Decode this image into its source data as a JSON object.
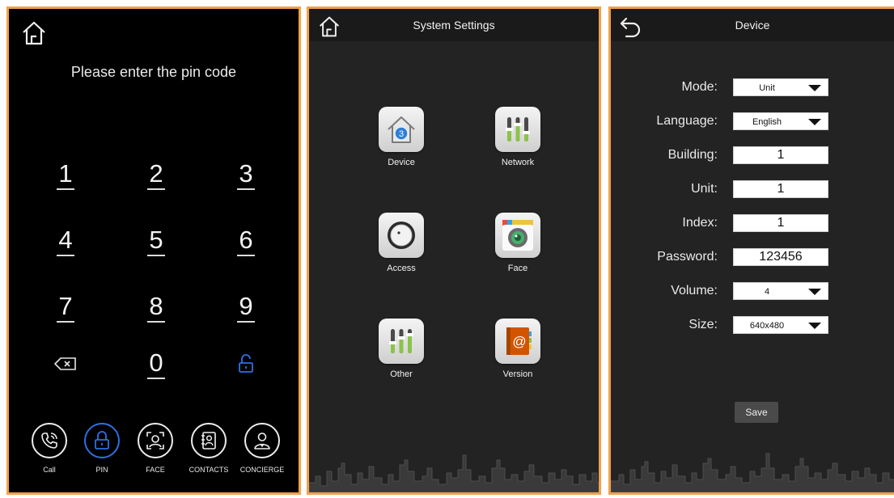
{
  "pin_screen": {
    "prompt": "Please enter the pin code",
    "keys": [
      "1",
      "2",
      "3",
      "4",
      "5",
      "6",
      "7",
      "8",
      "9",
      "0"
    ],
    "nav": [
      {
        "label": "Call",
        "icon": "phone-icon"
      },
      {
        "label": "PIN",
        "icon": "lock-icon"
      },
      {
        "label": "FACE",
        "icon": "face-scan-icon"
      },
      {
        "label": "CONTACTS",
        "icon": "contacts-icon"
      },
      {
        "label": "CONCIERGE",
        "icon": "concierge-icon"
      }
    ],
    "accent_color": "#2f6fe4"
  },
  "system_settings": {
    "title": "System Settings",
    "apps": [
      {
        "label": "Device",
        "icon": "device-house-icon",
        "badge": "3"
      },
      {
        "label": "Network",
        "icon": "network-sliders-icon"
      },
      {
        "label": "Access",
        "icon": "access-knob-icon"
      },
      {
        "label": "Face",
        "icon": "face-camera-icon"
      },
      {
        "label": "Other",
        "icon": "other-sliders-icon"
      },
      {
        "label": "Version",
        "icon": "version-book-icon"
      }
    ]
  },
  "device": {
    "title": "Device",
    "fields": {
      "mode": {
        "label": "Mode:",
        "value": "Unit"
      },
      "language": {
        "label": "Language:",
        "value": "English"
      },
      "building": {
        "label": "Building:",
        "value": "1"
      },
      "unit": {
        "label": "Unit:",
        "value": "1"
      },
      "index": {
        "label": "Index:",
        "value": "1"
      },
      "password": {
        "label": "Password:",
        "value": "123456"
      },
      "volume": {
        "label": "Volume:",
        "value": "4"
      },
      "size": {
        "label": "Size:",
        "value": "640x480"
      }
    },
    "save_label": "Save"
  },
  "colors": {
    "frame": "#f2a04a",
    "panel_bg": "#232323"
  }
}
